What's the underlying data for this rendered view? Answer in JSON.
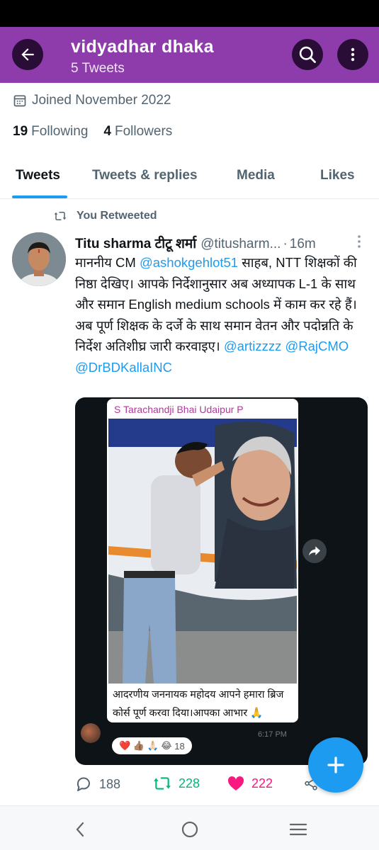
{
  "header": {
    "name": "vidyadhar dhaka",
    "tweet_count": "5 Tweets",
    "bg_color": "#8e3bab"
  },
  "profile": {
    "joined": "Joined November 2022",
    "following_count": "19",
    "following_label": "Following",
    "followers_count": "4",
    "followers_label": "Followers"
  },
  "tabs": [
    {
      "label": "Tweets",
      "active": true
    },
    {
      "label": "Tweets & replies",
      "active": false
    },
    {
      "label": "Media",
      "active": false
    },
    {
      "label": "Likes",
      "active": false
    }
  ],
  "tweet": {
    "retweet_label": "You Retweeted",
    "author_name": "Titu sharma टीटू शर्मा",
    "author_handle": "@titusharm...",
    "separator": "·",
    "time": "16m",
    "text_1": "माननीय CM ",
    "mention_1": "@ashokgehlot51",
    "text_2": " साहब, NTT शिक्षकों की निष्ठा देखिए। आपके निर्देशानुसार अब अध्यापक L-1 के साथ और समान English medium schools में काम कर रहे हैं। अब पूर्ण शिक्षक के दर्जे के साथ समान वेतन और पदोन्नति के निर्देश अतिशीघ्र जारी करवाइए। ",
    "mention_2": "@artizzzz",
    "mention_3": "@RajCMO",
    "mention_4": "@DrBDKallaINC",
    "media": {
      "sender": "S Tarachandji Bhai Udaipur P",
      "caption": "आदरणीय जननायक महोदय आपने हमारा ब्रिज कोर्स पूर्ण करवा दिया।आपका आभार 🙏",
      "time": "6:17 PM",
      "reactions": "❤️ 👍🏽 🙏🏻 😂",
      "reaction_count": "18"
    },
    "replies": "188",
    "retweets": "228",
    "likes": "222",
    "retweet_color": "#00ba7c",
    "like_color": "#f91880",
    "mention_color": "#1d9bf0"
  },
  "icons": {
    "back": "arrow-left-icon",
    "search": "search-icon",
    "more": "more-vertical-icon",
    "calendar": "calendar-icon",
    "retweet": "retweet-icon",
    "reply": "reply-icon",
    "like": "heart-icon",
    "share": "share-icon",
    "compose": "plus-icon",
    "nav_back": "chevron-left-icon",
    "nav_home": "circle-home-icon",
    "nav_recents": "menu-lines-icon"
  }
}
